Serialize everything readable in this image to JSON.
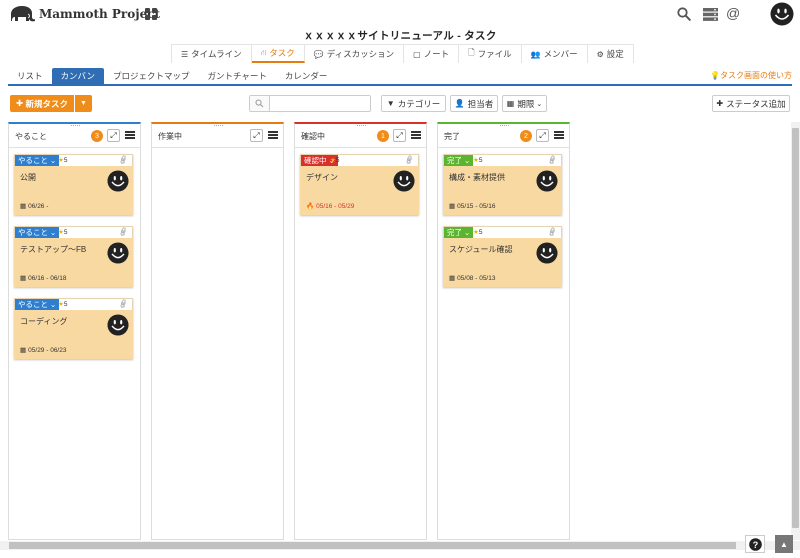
{
  "app": {
    "logo_text": "Mammoth Project"
  },
  "project_title": "ｘｘｘｘｘサイトリニューアル - タスク",
  "main_tabs": [
    {
      "label": "タイムライン",
      "icon": "list-icon"
    },
    {
      "label": "タスク",
      "icon": "sitemap-icon",
      "active": true
    },
    {
      "label": "ディスカッション",
      "icon": "comments-icon"
    },
    {
      "label": "ノート",
      "icon": "note-icon"
    },
    {
      "label": "ファイル",
      "icon": "file-icon"
    },
    {
      "label": "メンバー",
      "icon": "users-icon"
    },
    {
      "label": "設定",
      "icon": "gear-icon"
    }
  ],
  "view_tabs": [
    {
      "label": "リスト"
    },
    {
      "label": "カンバン",
      "active": true
    },
    {
      "label": "プロジェクトマップ"
    },
    {
      "label": "ガントチャート"
    },
    {
      "label": "カレンダー"
    }
  ],
  "help_link": "タスク画面の使い方",
  "toolbar": {
    "new_task": "新規タスク",
    "search_placeholder": "",
    "category": "カテゴリー",
    "assignee": "担当者",
    "deadline": "期限",
    "add_status": "ステータス追加"
  },
  "colors": {
    "accent": "#f08c1a",
    "view_tab": "#2f6db5",
    "todo": "#2f7fd0",
    "in_progress": "#e57c10",
    "review": "#d9302c",
    "done": "#5bb530",
    "card_bg": "#f9d9a2"
  },
  "columns": [
    {
      "title": "やること",
      "count": "3",
      "color": "#2f7fd0",
      "cards": [
        {
          "status": "やること",
          "stars": "5",
          "title": "公開",
          "date": "06/26 -"
        },
        {
          "status": "やること",
          "stars": "5",
          "title": "テストアップ～FB",
          "date": "06/16 - 06/18"
        },
        {
          "status": "やること",
          "stars": "5",
          "title": "コーディング",
          "date": "05/29 - 06/23"
        }
      ]
    },
    {
      "title": "作業中",
      "count": "",
      "color": "#e57c10",
      "cards": []
    },
    {
      "title": "確認中",
      "count": "1",
      "color": "#d9302c",
      "cards": [
        {
          "status": "確認中",
          "stars": "5",
          "title": "デザイン",
          "date": "05/16 - 05/29",
          "late": true
        }
      ]
    },
    {
      "title": "完了",
      "count": "2",
      "color": "#5bb530",
      "cards": [
        {
          "status": "完了",
          "stars": "5",
          "title": "構成・素材提供",
          "date": "05/15 - 05/16"
        },
        {
          "status": "完了",
          "stars": "5",
          "title": "スケジュール確認",
          "date": "05/08 - 05/13"
        }
      ]
    }
  ]
}
